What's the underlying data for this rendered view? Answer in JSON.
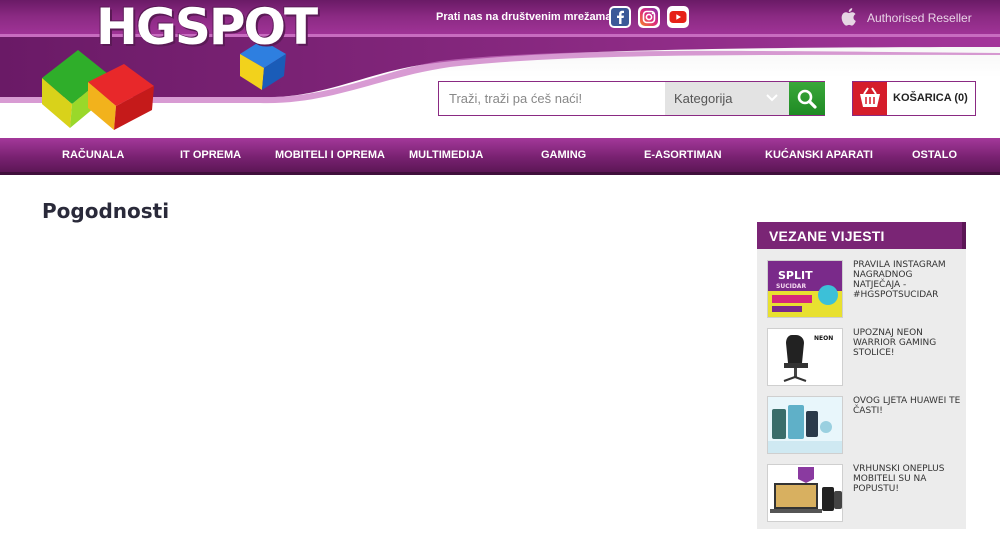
{
  "topbar": {
    "social_text": "Prati nas na društvenim mrežama!",
    "reseller": "Authorised Reseller",
    "icons": [
      "facebook-icon",
      "instagram-icon",
      "youtube-icon",
      "apple-icon"
    ]
  },
  "logo": {
    "text": "HGSPOT"
  },
  "search": {
    "placeholder": "Traži, traži pa ćeš naći!",
    "category": "Kategorija"
  },
  "cart": {
    "label": "KOŠARICA (0)"
  },
  "nav": {
    "items": [
      "RAČUNALA",
      "IT OPREMA",
      "MOBITELI I OPREMA",
      "MULTIMEDIJA",
      "GAMING",
      "E-ASORTIMAN",
      "KUĆANSKI APARATI",
      "OSTALO"
    ]
  },
  "page": {
    "title": "Pogodnosti"
  },
  "sidebar": {
    "heading": "VEZANE VIJESTI",
    "news": [
      {
        "title": "PRAVILA INSTAGRAM NAGRADNOG NATJEČAJA - #HGSPOTSUCIDAR",
        "thumb_text": "SPLIT",
        "thumb_sub": "SUCIDAR"
      },
      {
        "title": "UPOZNAJ NEON WARRIOR GAMING STOLICE!",
        "thumb_text": "NEON"
      },
      {
        "title": "OVOG LJETA HUAWEI TE ČASTI!"
      },
      {
        "title": "VRHUNSKI ONEPLUS MOBITELI SU NA POPUSTU!"
      }
    ]
  },
  "colors": {
    "brand_purple": "#8b2a83",
    "nav_purple": "#7a2272",
    "search_green": "#2a9a2e",
    "cart_red": "#d51d2b"
  }
}
